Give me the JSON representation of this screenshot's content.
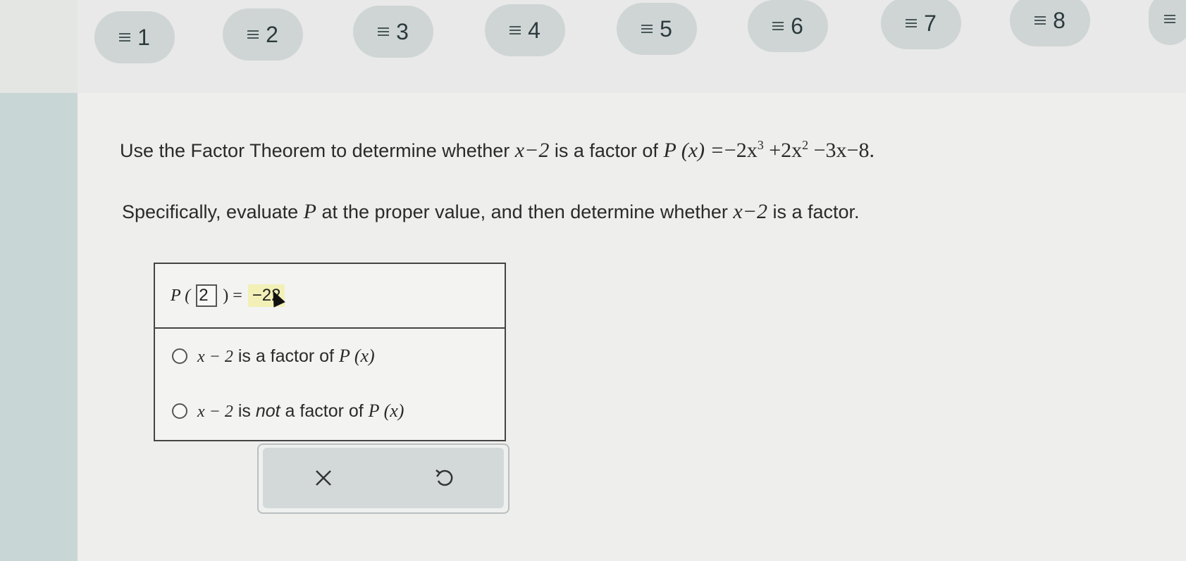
{
  "nav": {
    "questions": [
      "1",
      "2",
      "3",
      "4",
      "5",
      "6",
      "7",
      "8"
    ],
    "icon": "menu-lines-icon"
  },
  "question": {
    "lead": "Use the Factor Theorem to determine whether",
    "factor": "x−2",
    "mid": "is a factor of",
    "poly_lhs": "P (x) =",
    "poly_rhs_1": "−2x",
    "exp1": "3",
    "poly_rhs_2": "+2x",
    "exp2": "2",
    "poly_rhs_3": "−3x−8.",
    "instruction_a": "Specifically, evaluate",
    "instruction_var": "P",
    "instruction_b": "at the proper value, and then determine whether",
    "instruction_factor": "x−2",
    "instruction_c": "is a factor."
  },
  "answer": {
    "eval_prefix": "P (",
    "eval_input": "2",
    "eval_suffix": ") =",
    "eval_value": "−22",
    "option1_expr": "x − 2",
    "option1_text": "is a factor of",
    "option1_p": "P (x)",
    "option2_expr": "x − 2",
    "option2_is": "is",
    "option2_not": "not",
    "option2_text": "a factor of",
    "option2_p": "P (x)"
  },
  "controls": {
    "clear_icon": "close-icon",
    "undo_icon": "undo-icon"
  }
}
